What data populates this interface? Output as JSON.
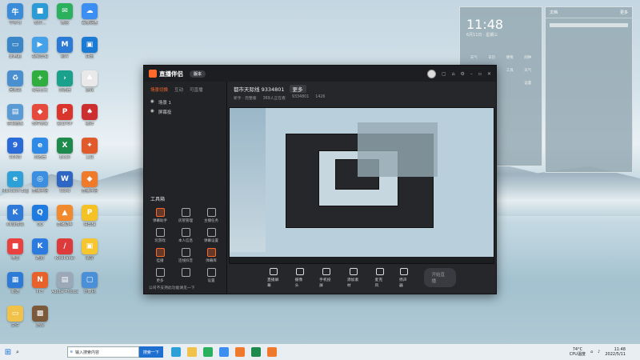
{
  "desktop_icons": [
    {
      "label": "牛学习",
      "color": "#3a8cd8",
      "glyph": "牛"
    },
    {
      "label": "软件...",
      "color": "#2b9bd6",
      "glyph": "■"
    },
    {
      "label": "微信",
      "color": "#2bb15d",
      "glyph": "✉"
    },
    {
      "label": "百度网盘",
      "color": "#3c8ef0",
      "glyph": "☁"
    },
    {
      "label": "此电脑",
      "color": "#3b86c9",
      "glyph": "▭"
    },
    {
      "label": "视频剪辑",
      "color": "#45a2e8",
      "glyph": "▶"
    },
    {
      "label": "照片",
      "color": "#2a7ad6",
      "glyph": "M"
    },
    {
      "label": "好压",
      "color": "#1b7bd2",
      "glyph": "▣"
    },
    {
      "label": "回收站",
      "color": "#4a8fd0",
      "glyph": "♻"
    },
    {
      "label": "安全卫士",
      "color": "#2fae3f",
      "glyph": "+"
    },
    {
      "label": "浏览器",
      "color": "#1aa18c",
      "glyph": "›"
    },
    {
      "label": "游戏",
      "color": "#e9e9e9",
      "glyph": "♣"
    },
    {
      "label": "控制面板",
      "color": "#5b9bd5",
      "glyph": "▤"
    },
    {
      "label": "软件管家",
      "color": "#e64a3c",
      "glyph": "◆"
    },
    {
      "label": "金山PDF",
      "color": "#d9352c",
      "glyph": "P"
    },
    {
      "label": "纸牌",
      "color": "#cc2f2f",
      "glyph": "♠"
    },
    {
      "label": "9ONO",
      "color": "#2a6bd8",
      "glyph": "9"
    },
    {
      "label": "浏览器",
      "color": "#2e8ae6",
      "glyph": "e"
    },
    {
      "label": "Excel",
      "color": "#1e8a4c",
      "glyph": "X"
    },
    {
      "label": "工具",
      "color": "#e05a2b",
      "glyph": "✦"
    },
    {
      "label": "Microsoft Edge",
      "color": "#2da0d8",
      "glyph": "e"
    },
    {
      "label": "直播伴侣",
      "color": "#3c8ee0",
      "glyph": "◎"
    },
    {
      "label": "Word",
      "color": "#2d66c3",
      "glyph": "W"
    },
    {
      "label": "直播伴侣",
      "color": "#ef7a2b",
      "glyph": "◆"
    },
    {
      "label": "KK录像机",
      "color": "#2f7ad8",
      "glyph": "K"
    },
    {
      "label": "QQ",
      "color": "#1f7be0",
      "glyph": "Q"
    },
    {
      "label": "直播助手",
      "color": "#f08a2d",
      "glyph": "▲"
    },
    {
      "label": "快剪辑",
      "color": "#f4c224",
      "glyph": "P"
    },
    {
      "label": "喷墨",
      "color": "#e94040",
      "glyph": "■"
    },
    {
      "label": "酷狗",
      "color": "#2a7ae0",
      "glyph": "K"
    },
    {
      "label": "KinkPanel",
      "color": "#dd3b3b",
      "glyph": "∕"
    },
    {
      "label": "录屏",
      "color": "#f5c630",
      "glyph": "▣"
    },
    {
      "label": "新建",
      "color": "#2d7bd6",
      "glyph": "▦"
    },
    {
      "label": "PPT",
      "color": "#e8612b",
      "glyph": "N"
    },
    {
      "label": "Adobe Photoshop",
      "color": "#9aa8b8",
      "glyph": "▤"
    },
    {
      "label": "计算机",
      "color": "#4a8fd8",
      "glyph": "▢"
    },
    {
      "label": "文件",
      "color": "#f0c24a",
      "glyph": "▭"
    },
    {
      "label": "游戏",
      "color": "#7a5a3a",
      "glyph": "▩"
    }
  ],
  "window": {
    "app_name": "直播伴侣",
    "version_badge": "版本",
    "side_tabs": [
      "场景切换",
      "互动",
      "可直播"
    ],
    "scenes": [
      "场景 1",
      "屏幕投"
    ],
    "tools_title": "工具箱",
    "tools": [
      "弹幕助手",
      "房管管理",
      "主播任务",
      "玩游戏",
      "本人信息",
      "弹幕设置",
      "挂播",
      "连线抖音",
      "弹幕库",
      "更多",
      "",
      "设置"
    ],
    "notice": "公司不支持此功能请见一下",
    "room_title": "都市天际线 9334801",
    "room_tag": "更多",
    "room_sub": [
      "新手 · 完整版",
      "369人正在看",
      "9334801",
      "1426"
    ],
    "bottom_tools": [
      "直播屏幕",
      "摄像头",
      "手机投屏",
      "添加素材",
      "麦克风",
      "扬声器"
    ],
    "start_label": "开始直播"
  },
  "widgets": {
    "time": "11:48",
    "date": "6月11日 · 星期三",
    "grid": [
      "天气",
      "日历",
      "便笺",
      "闹钟",
      "设置",
      "图片",
      "工具",
      "天气",
      "笔记",
      "",
      "",
      "设置"
    ],
    "notes_title": "文档",
    "notes_tab": "更多"
  },
  "taskbar": {
    "search_placeholder": "输入搜索内容",
    "search_button": "搜索一下",
    "weather_temp": "74°C",
    "weather_label": "CPU温度",
    "time": "11:48",
    "date": "2022/5/11"
  }
}
